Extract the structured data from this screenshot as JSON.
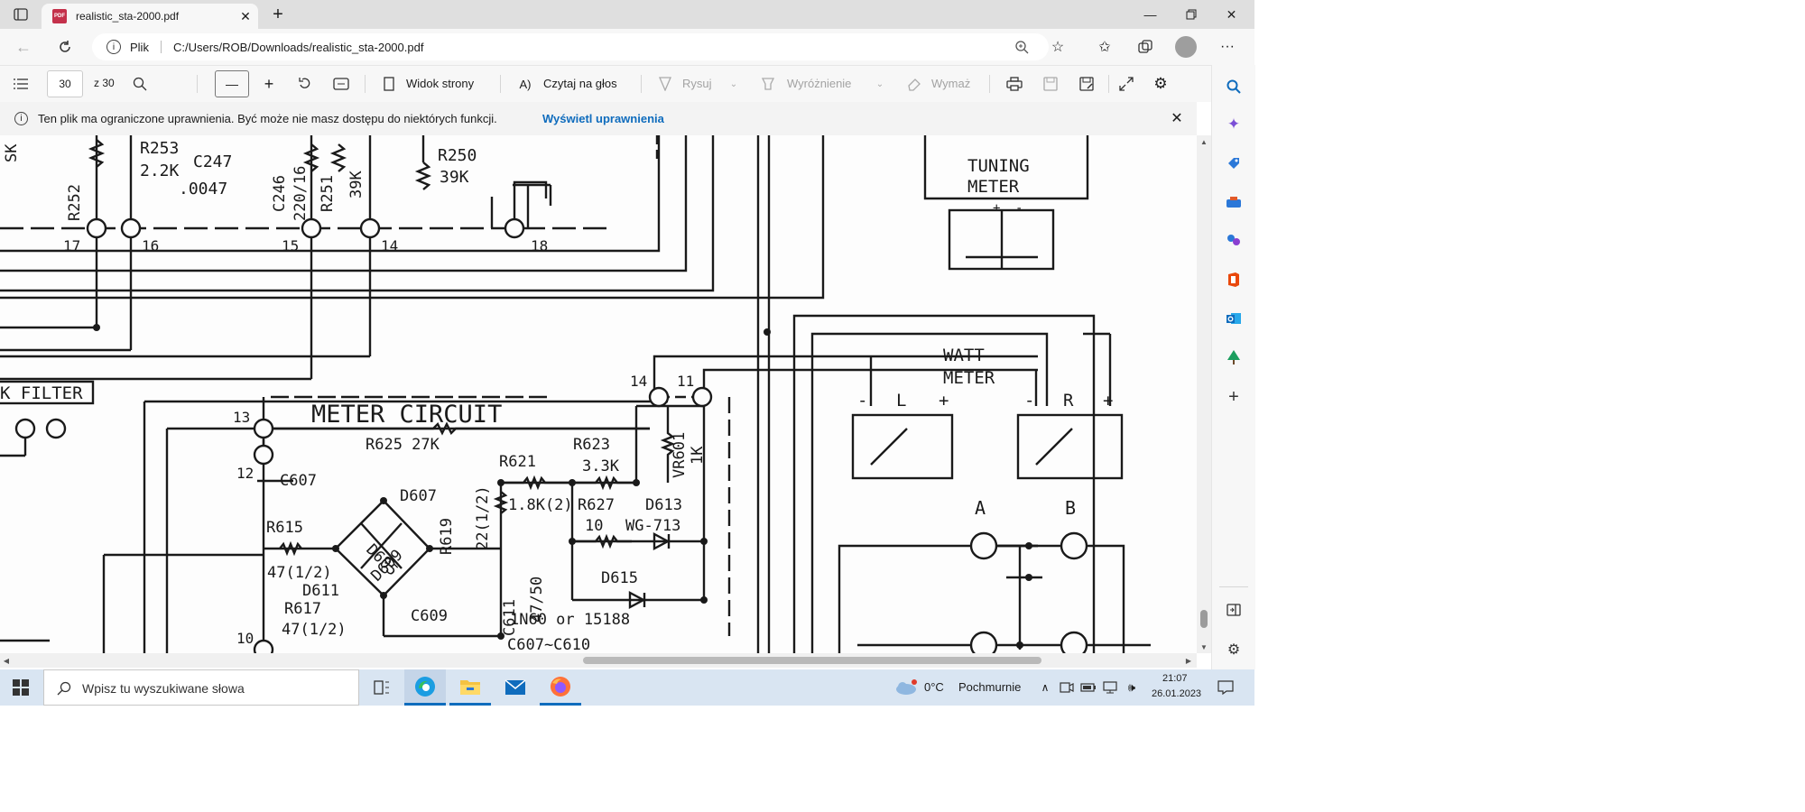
{
  "browser": {
    "tab_title": "realistic_sta-2000.pdf",
    "pdf_badge": "PDF",
    "address_scheme": "Plik",
    "address_url": "C:/Users/ROB/Downloads/realistic_sta-2000.pdf"
  },
  "pdf_toolbar": {
    "page_current": "30",
    "page_total": "z 30",
    "page_view_label": "Widok strony",
    "read_aloud_label": "Czytaj na głos",
    "draw_label": "Rysuj",
    "highlight_label": "Wyróżnienie",
    "erase_label": "Wymaż"
  },
  "infobar": {
    "message": "Ten plik ma ograniczone uprawnienia. Być może nie masz dostępu do niektórych funkcji.",
    "link": "Wyświetl uprawnienia"
  },
  "schematic": {
    "labels": {
      "r253": "R253",
      "r253_val": "2.2K",
      "c247": "C247",
      "c247_val": ".0047",
      "c246": "C246",
      "c246_val": "220/16",
      "r251": "R251",
      "r251_val": "39K",
      "r252": "R252",
      "r250": "R250",
      "r250_val": "39K",
      "sk": "SK",
      "t17": "17",
      "t16": "16",
      "t15": "15",
      "t14": "14",
      "t18": "18",
      "filter": "K FILTER",
      "meter_circuit": "METER CIRCUIT",
      "t13": "13",
      "t12": "12",
      "t10": "10",
      "t14b": "14",
      "t11": "11",
      "r625": "R625 27K",
      "r623": "R623",
      "r623_val": "3.3K",
      "vr601": "VR601",
      "vr601_val": "1K",
      "r621": "R621",
      "c607": "C607",
      "d607": "D607",
      "r615": "R615",
      "r615_val": "47(1/2)",
      "d605": "D605",
      "d609": "D609",
      "r619": "R619",
      "r619_val": "22(1/2)",
      "r611_val": "1.8K(2)",
      "r627": "R627",
      "r627_val": "10",
      "d613": "D613",
      "wg": "WG-713",
      "d611": "D611",
      "r617": "R617",
      "r617_val": "47(1/2)",
      "c609": "C609",
      "c611": "C611",
      "c611_val": "47/50",
      "d615": "D615",
      "in60": "1N60 or 15188",
      "c607_610": "C607~C610",
      "tuning": "TUNING",
      "meter": "METER",
      "watt": "WATT",
      "watt_meter": "METER",
      "l": "L",
      "r": "R",
      "a": "A",
      "b": "B",
      "plus": "+",
      "minus": "-"
    }
  },
  "taskbar": {
    "search_placeholder": "Wpisz tu wyszukiwane słowa",
    "weather_temp": "0°C",
    "weather_desc": "Pochmurnie",
    "time": "21:07",
    "date": "26.01.2023"
  },
  "colors": {
    "accent": "#0f6cbd",
    "taskbar": "#d9e5f2",
    "chrome": "#f7f7f7"
  }
}
